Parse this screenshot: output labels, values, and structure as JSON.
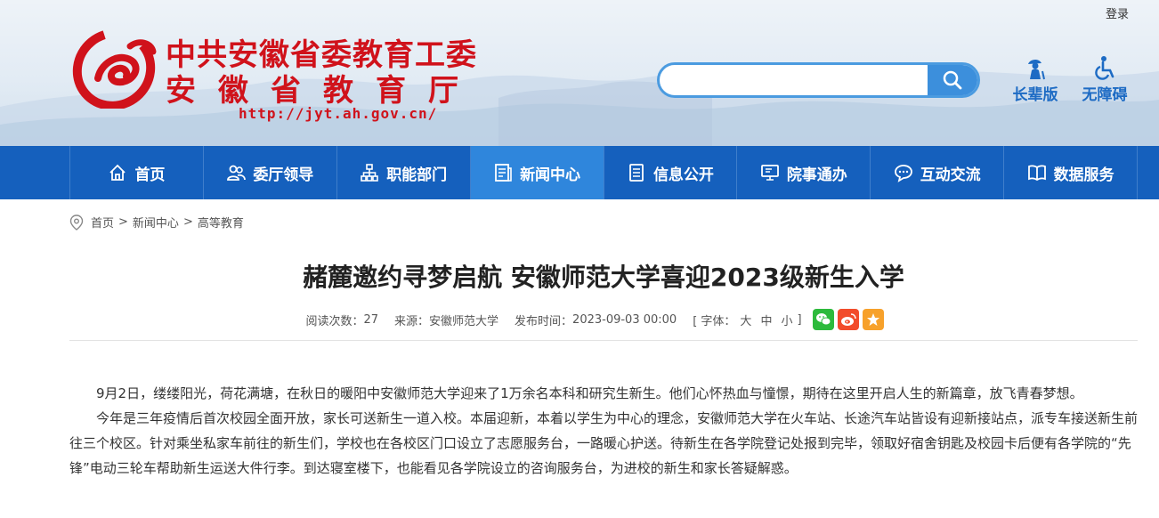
{
  "header": {
    "login_label": "登录",
    "logo_line1": "中共安徽省委教育工委",
    "logo_line2": "安徽省教育厅",
    "logo_url": "http://jyt.ah.gov.cn/",
    "search_placeholder": "",
    "elder_mode_label": "长辈版",
    "accessibility_label": "无障碍",
    "brand_color": "#d0121b",
    "accent_color": "#1560bd"
  },
  "nav": {
    "items": [
      {
        "label": "首页",
        "icon": "home-icon"
      },
      {
        "label": "委厅领导",
        "icon": "people-icon"
      },
      {
        "label": "职能部门",
        "icon": "org-chart-icon"
      },
      {
        "label": "新闻中心",
        "icon": "news-icon",
        "active": true
      },
      {
        "label": "信息公开",
        "icon": "document-icon"
      },
      {
        "label": "院事通办",
        "icon": "monitor-icon"
      },
      {
        "label": "互动交流",
        "icon": "chat-icon"
      },
      {
        "label": "数据服务",
        "icon": "book-icon"
      }
    ]
  },
  "breadcrumb": {
    "items": [
      "首页",
      "新闻中心",
      "高等教育"
    ],
    "separator": ">"
  },
  "article": {
    "title": "赭麓邀约寻梦启航 安徽师范大学喜迎2023级新生入学",
    "reads_label": "阅读次数：",
    "reads_value": "27",
    "source_label": "来源：",
    "source_value": "安徽师范大学",
    "published_label": "发布时间：",
    "published_value": "2023-09-03 00:00",
    "font_open": "[ 字体：",
    "font_large": "大",
    "font_medium": "中",
    "font_small": "小",
    "font_close": "]",
    "paragraphs": [
      "9月2日，缕缕阳光，荷花满塘，在秋日的暖阳中安徽师范大学迎来了1万余名本科和研究生新生。他们心怀热血与憧憬，期待在这里开启人生的新篇章，放飞青春梦想。",
      "今年是三年疫情后首次校园全面开放，家长可送新生一道入校。本届迎新，本着以学生为中心的理念，安徽师范大学在火车站、长途汽车站皆设有迎新接站点，派专车接送新生前往三个校区。针对乘坐私家车前往的新生们，学校也在各校区门口设立了志愿服务台，一路暖心护送。待新生在各学院登记处报到完毕，领取好宿舍钥匙及校园卡后便有各学院的“先锋”电动三轮车帮助新生运送大件行李。到达寝室楼下，也能看见各学院设立的咨询服务台，为进校的新生和家长答疑解惑。"
    ],
    "share_colors": {
      "wechat": "#2dba3c",
      "weibo": "#f24c2b",
      "favorite": "#f7a12b"
    }
  }
}
